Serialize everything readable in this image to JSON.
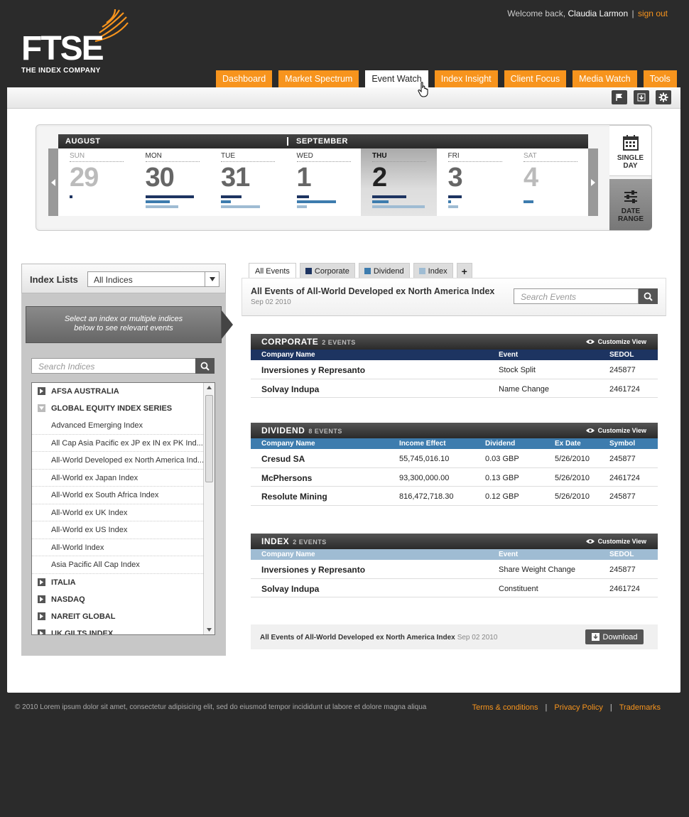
{
  "brand": {
    "logo_text": "FTSE",
    "logo_sub": "THE INDEX COMPANY",
    "accent": "#f7941d"
  },
  "user": {
    "welcome_prefix": "Welcome back,",
    "name": "Claudia Larmon",
    "separator": "|",
    "signout": "sign out"
  },
  "nav": [
    {
      "label": "Dashboard",
      "active": false
    },
    {
      "label": "Market Spectrum",
      "active": false
    },
    {
      "label": "Event Watch",
      "active": true
    },
    {
      "label": "Index Insight",
      "active": false
    },
    {
      "label": "Client Focus",
      "active": false
    },
    {
      "label": "Media Watch",
      "active": false
    },
    {
      "label": "Tools",
      "active": false
    }
  ],
  "toolbar_icons": [
    "flag-icon",
    "download-icon",
    "gear-icon"
  ],
  "calendar": {
    "months": [
      "AUGUST",
      "SEPTEMBER"
    ],
    "days": [
      {
        "name": "SUN",
        "num": "29",
        "bars": {
          "c": 0.05,
          "d": 0,
          "i": 0
        }
      },
      {
        "name": "MON",
        "num": "30",
        "bars": {
          "c": 0.9,
          "d": 0.45,
          "i": 0.6
        }
      },
      {
        "name": "TUE",
        "num": "31",
        "bars": {
          "c": 0.38,
          "d": 0.18,
          "i": 0.72
        }
      },
      {
        "name": "WED",
        "num": "1",
        "bars": {
          "c": 0.23,
          "d": 0.72,
          "i": 0.18
        }
      },
      {
        "name": "THU",
        "num": "2",
        "bars": {
          "c": 0.63,
          "d": 0.3,
          "i": 0.97
        }
      },
      {
        "name": "FRI",
        "num": "3",
        "bars": {
          "c": 0.25,
          "d": 0.05,
          "i": 0.18
        }
      },
      {
        "name": "SAT",
        "num": "4",
        "bars": {
          "c": 0,
          "d": 0.18,
          "i": 0
        }
      }
    ],
    "selected_index": 4,
    "views": {
      "single": [
        "SINGLE",
        "DAY"
      ],
      "range": [
        "DATE",
        "RANGE"
      ]
    },
    "colors": {
      "corporate": "#1d3461",
      "dividend": "#3d7cae",
      "index": "#9fbcd3"
    }
  },
  "sidebar": {
    "title": "Index Lists",
    "select_value": "All Indices",
    "hint": [
      "Select an index or multiple indices",
      "below to see relevant events"
    ],
    "search_placeholder": "Search Indices",
    "items": [
      {
        "label": "AFSA AUSTRALIA",
        "type": "group",
        "open": false
      },
      {
        "label": "GLOBAL EQUITY INDEX SERIES",
        "type": "group",
        "open": true
      },
      {
        "label": "Advanced Emerging Index",
        "type": "item"
      },
      {
        "label": "All Cap Asia Pacific ex JP ex IN  ex PK Ind...",
        "type": "item"
      },
      {
        "label": "All-World Developed ex North America Ind...",
        "type": "item"
      },
      {
        "label": "All-World ex Japan Index",
        "type": "item"
      },
      {
        "label": "All-World ex South Africa Index",
        "type": "item"
      },
      {
        "label": "All-World ex UK Index",
        "type": "item"
      },
      {
        "label": "All-World ex US Index",
        "type": "item"
      },
      {
        "label": "All-World Index",
        "type": "item"
      },
      {
        "label": "Asia Pacific All Cap Index",
        "type": "item"
      },
      {
        "label": "ITALIA",
        "type": "group",
        "open": false
      },
      {
        "label": "NASDAQ",
        "type": "group",
        "open": false
      },
      {
        "label": "NAREIT GLOBAL",
        "type": "group",
        "open": false
      },
      {
        "label": "UK GILTS INDEX",
        "type": "group",
        "open": false
      }
    ]
  },
  "events": {
    "tabs": [
      {
        "label": "All Events",
        "color": ""
      },
      {
        "label": "Corporate",
        "color": "#1d3461"
      },
      {
        "label": "Dividend",
        "color": "#3d7cae"
      },
      {
        "label": "Index",
        "color": "#9fbcd3"
      },
      {
        "label": "+",
        "color": ""
      }
    ],
    "title": "All Events of All-World Developed ex North America Index",
    "date": "Sep 02 2010",
    "search_placeholder": "Search Events",
    "customize_label": "Customize View",
    "sections": [
      {
        "name": "CORPORATE",
        "count": "2 EVENTS",
        "color": "#1d3461",
        "columns": [
          "Company Name",
          "Event",
          "SEDOL"
        ],
        "rows": [
          [
            "Inversiones y Represanto",
            "Stock Split",
            "245877"
          ],
          [
            "Solvay Indupa",
            "Name Change",
            "2461724"
          ]
        ]
      },
      {
        "name": "DIVIDEND",
        "count": "8 EVENTS",
        "color": "#3d7cae",
        "columns": [
          "Company Name",
          "Income Effect",
          "Dividend",
          "Ex Date",
          "Symbol"
        ],
        "rows": [
          [
            "Cresud SA",
            "55,745,016.10",
            "0.03 GBP",
            "5/26/2010",
            "245877"
          ],
          [
            "McPhersons",
            "93,300,000.00",
            "0.13 GBP",
            "5/26/2010",
            "2461724"
          ],
          [
            "Resolute Mining",
            "816,472,718.30",
            "0.12 GBP",
            "5/26/2010",
            "245877"
          ]
        ]
      },
      {
        "name": "INDEX",
        "count": "2 EVENTS",
        "color": "#9fbcd3",
        "columns": [
          "Company Name",
          "Event",
          "SEDOL"
        ],
        "rows": [
          [
            "Inversiones y Represanto",
            "Share Weight Change",
            "245877"
          ],
          [
            "Solvay Indupa",
            "Constituent",
            "2461724"
          ]
        ]
      }
    ],
    "footer_title": "All Events of All-World Developed ex North America Index",
    "footer_date": "Sep 02 2010",
    "download_label": "Download"
  },
  "footer": {
    "copyright": "© 2010 Lorem ipsum dolor sit amet, consectetur adipisicing elit, sed do eiusmod tempor incididunt ut labore et dolore magna aliqua",
    "links": [
      "Terms & conditions",
      "Privacy Policy",
      "Trademarks"
    ],
    "separator": "|"
  }
}
